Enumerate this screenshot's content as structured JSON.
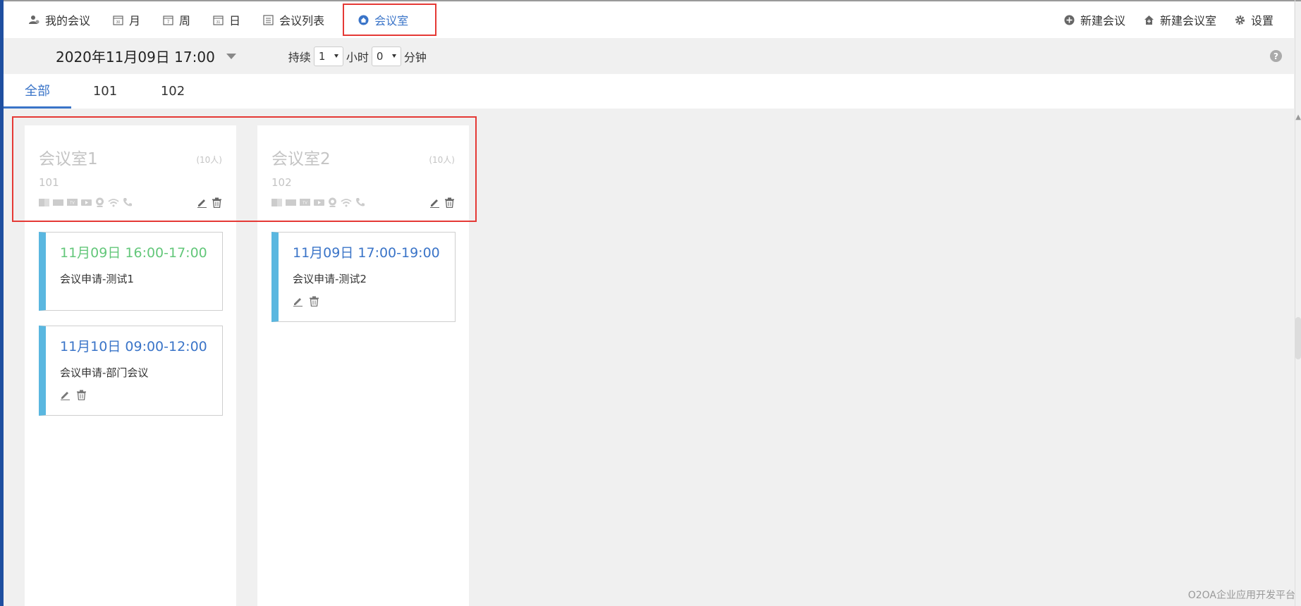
{
  "nav": {
    "left": [
      {
        "label": "我的会议",
        "icon": "user-icon"
      },
      {
        "label": "月",
        "icon": "calendar-month-icon"
      },
      {
        "label": "周",
        "icon": "calendar-week-icon"
      },
      {
        "label": "日",
        "icon": "calendar-day-icon"
      },
      {
        "label": "会议列表",
        "icon": "list-icon"
      },
      {
        "label": "会议室",
        "icon": "home-icon"
      }
    ],
    "right": [
      {
        "label": "新建会议",
        "icon": "plus-circle-icon"
      },
      {
        "label": "新建会议室",
        "icon": "house-plus-icon"
      },
      {
        "label": "设置",
        "icon": "gear-icon"
      }
    ],
    "cal_month_num": "30",
    "cal_week_num": "7",
    "cal_day_num": "31"
  },
  "toolbar": {
    "datetime": "2020年11月09日 17:00",
    "duration_label": "持续",
    "hours_value": "1",
    "hours_unit": "小时",
    "minutes_value": "0",
    "minutes_unit": "分钟",
    "help": "?"
  },
  "tabs": [
    {
      "label": "全部",
      "active": true
    },
    {
      "label": "101",
      "active": false
    },
    {
      "label": "102",
      "active": false
    }
  ],
  "rooms": [
    {
      "name": "会议室1",
      "capacity": "(10人)",
      "number": "101",
      "meetings": [
        {
          "time": "11月09日 16:00-17:00",
          "title": "会议申请-测试1",
          "color": "#63c77a",
          "actions": false
        },
        {
          "time": "11月10日 09:00-12:00",
          "title": "会议申请-部门会议",
          "color": "#3a74c8",
          "actions": true
        }
      ]
    },
    {
      "name": "会议室2",
      "capacity": "(10人)",
      "number": "102",
      "meetings": [
        {
          "time": "11月09日 17:00-19:00",
          "title": "会议申请-测试2",
          "color": "#3a74c8",
          "actions": true
        }
      ]
    }
  ],
  "amenity_icons": [
    "projector-icon",
    "board-icon",
    "tv-icon",
    "video-icon",
    "camera-icon",
    "wifi-icon",
    "phone-icon"
  ],
  "amenity_tv_text": "TV",
  "scroll_arrow": "▲",
  "footer": "O2OA企业应用开发平台",
  "colors": {
    "accent": "#3a74c8",
    "success": "#63c77a",
    "highlight": "#e53935"
  }
}
